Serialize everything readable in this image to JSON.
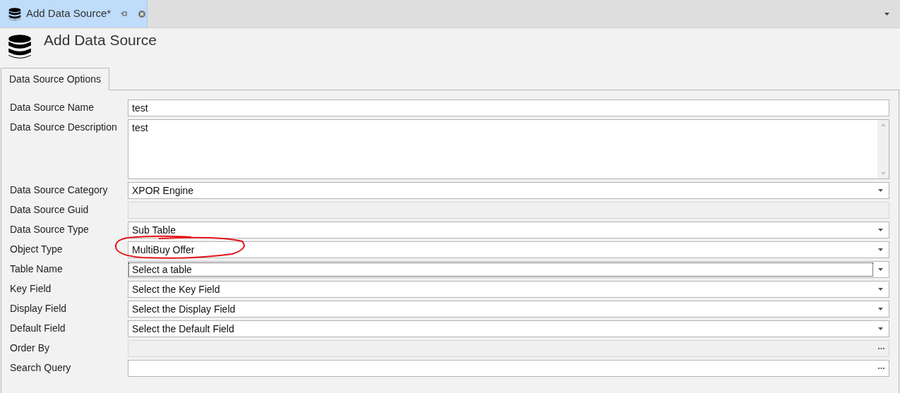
{
  "document_tab": {
    "label": "Add Data Source*",
    "selected": true
  },
  "header": {
    "title": "Add Data Source"
  },
  "group_tab": {
    "label": "Data Source Options",
    "selected": true
  },
  "fields": [
    {
      "label": "Data Source Name",
      "kind": "text",
      "value": "test",
      "disabled": false
    },
    {
      "label": "Data Source Description",
      "kind": "memo",
      "value": "test",
      "disabled": false
    },
    {
      "label": "Data Source Category",
      "kind": "combo",
      "value": "XPOR Engine",
      "disabled": false
    },
    {
      "label": "Data Source Guid",
      "kind": "text",
      "disabled": true
    },
    {
      "label": "Data Source Type",
      "kind": "combo",
      "value": "Sub Table",
      "disabled": false
    },
    {
      "label": "Object Type",
      "kind": "combo",
      "value": "MultiBuy Offer",
      "disabled": false,
      "circled": true
    },
    {
      "label": "Table Name",
      "kind": "combo",
      "value": "Select a table",
      "disabled": false,
      "focused": true
    },
    {
      "label": "Key Field",
      "kind": "combo",
      "value": "Select the Key Field",
      "disabled": false
    },
    {
      "label": "Display Field",
      "kind": "combo",
      "value": "Select the Display Field",
      "disabled": false
    },
    {
      "label": "Default Field",
      "kind": "combo",
      "value": "Select the Default Field",
      "disabled": false
    },
    {
      "label": "Order By",
      "kind": "ellipsis",
      "disabled": true
    },
    {
      "label": "Search Query",
      "kind": "ellipsis",
      "disabled": false
    }
  ]
}
